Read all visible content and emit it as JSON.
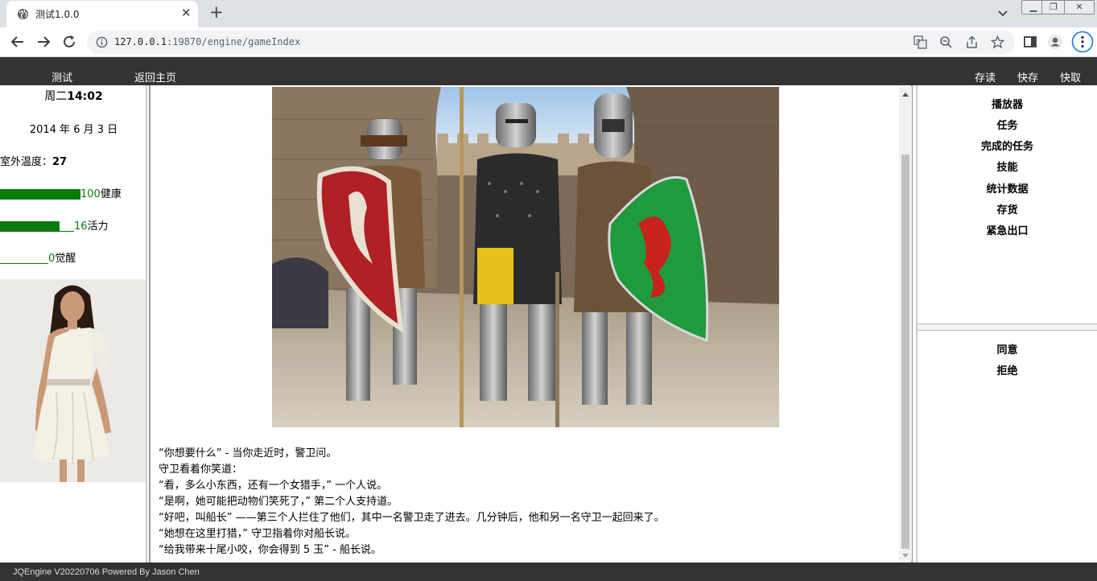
{
  "browser": {
    "tab_title": "测试1.0.0",
    "url_host": "127.0.0.1",
    "url_rest": ":19870/engine/gameIndex"
  },
  "topnav": {
    "left": [
      "测试",
      "返回主页"
    ],
    "right": [
      "存读",
      "快存",
      "快取"
    ]
  },
  "status": {
    "weekday": "周二",
    "time": "14:02",
    "date": "2014 年 6 月 3 日",
    "temp_label": "室外温度：",
    "temp_value": "27",
    "stats": [
      {
        "value": "100",
        "label": "健康",
        "fraction": 1.0
      },
      {
        "value": "16",
        "label": "活力",
        "fraction": 0.8
      },
      {
        "value": "0",
        "label": "觉醒",
        "fraction": 0.0
      }
    ]
  },
  "story": [
    "“你想要什么” - 当你走近时，警卫问。",
    "守卫看着你笑道：",
    "“看，多么小东西，还有一个女猎手，” 一个人说。",
    "“是啊，她可能把动物们笑死了，” 第二个人支持道。",
    "“好吧，叫船长” ——第三个人拦住了他们，其中一名警卫走了进去。几分钟后，他和另一名守卫一起回来了。",
    "“她想在这里打猎，” 守卫指着你对船长说。",
    "“给我带来十尾小咬，你会得到 5 玉” - 船长说。"
  ],
  "menu": [
    "播放器",
    "任务",
    "完成的任务",
    "技能",
    "统计数据",
    "存货",
    "紧急出口"
  ],
  "choices": [
    "同意",
    "拒绝"
  ],
  "footer": "JQEngine V20220706 Powered By Jason Chen",
  "colors": {
    "bar": "#0a7a0a",
    "nav": "#333333"
  }
}
